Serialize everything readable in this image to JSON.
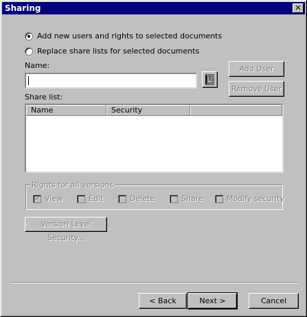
{
  "window": {
    "title": "Sharing",
    "close_glyph": "✕"
  },
  "options": {
    "add_new": "Add new users and rights to selected documents",
    "replace": "Replace share lists for selected documents"
  },
  "name_field": {
    "label": "Name:",
    "value": ""
  },
  "buttons": {
    "add_user": "Add User",
    "remove_user": "Remove User",
    "version_level_security": "Version Level Security...",
    "back": "< Back",
    "next": "Next >",
    "cancel": "Cancel"
  },
  "share_list": {
    "label": "Share list:",
    "columns": [
      "Name",
      "Security"
    ],
    "rows": []
  },
  "rights_group": {
    "legend": "Rights for all versions",
    "checkboxes": [
      {
        "label": "View",
        "checked": true
      },
      {
        "label": "Edit",
        "checked": false
      },
      {
        "label": "Delete",
        "checked": false
      },
      {
        "label": "Share",
        "checked": false
      },
      {
        "label": "Modify security",
        "checked": false
      }
    ]
  },
  "icons": {
    "address_book": "address-book-icon"
  },
  "colors": {
    "titlebar": "#000080",
    "face": "#c0c0c0",
    "disabled_text": "#808080"
  }
}
